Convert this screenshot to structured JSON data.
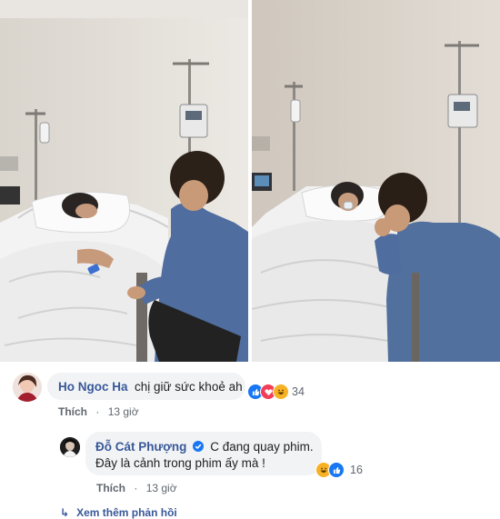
{
  "comments": [
    {
      "author": "Ho Ngoc Ha",
      "text": "chị giữ sức khoẻ ah",
      "reaction_count": "34",
      "reactions": [
        "like-icon",
        "love-icon",
        "haha-icon"
      ],
      "like_label": "Thích",
      "time": "13 giờ"
    }
  ],
  "reply": {
    "author": "Đỗ Cát Phượng",
    "verified": true,
    "line1": "C đang quay phim.",
    "line2": "Đây là cảnh trong phim ấy mà !",
    "reaction_count": "16",
    "reactions": [
      "haha-icon",
      "like-icon"
    ],
    "like_label": "Thích",
    "time": "13 giờ"
  },
  "more_replies": "Xem thêm phản hồi",
  "colors": {
    "name": "#385898",
    "bubble": "#f2f3f5",
    "like_blue": "#1877f2",
    "love_red": "#f33e58",
    "haha_yellow": "#f7b125"
  }
}
